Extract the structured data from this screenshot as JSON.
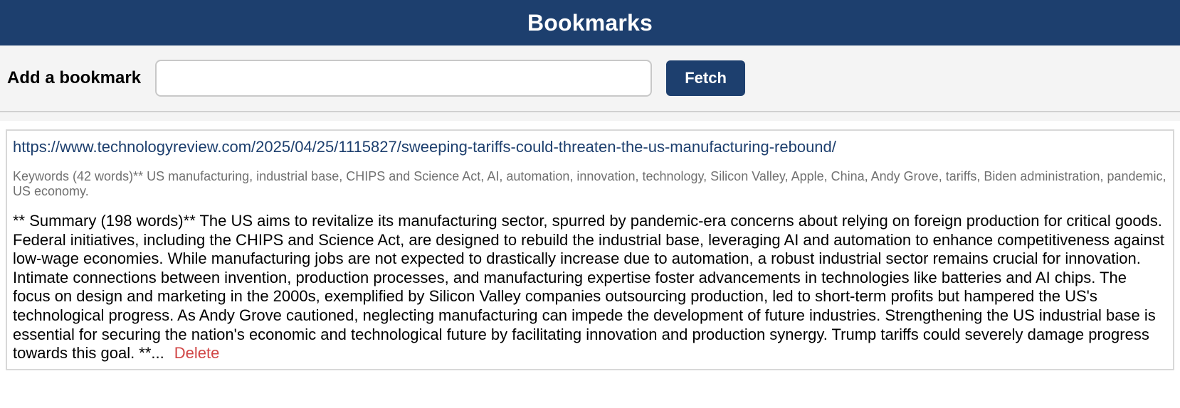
{
  "header": {
    "title": "Bookmarks"
  },
  "add_bookmark": {
    "label": "Add a bookmark",
    "input_value": "",
    "input_placeholder": "",
    "fetch_label": "Fetch"
  },
  "bookmarks": [
    {
      "url": "https://www.technologyreview.com/2025/04/25/1115827/sweeping-tariffs-could-threaten-the-us-manufacturing-rebound/",
      "keywords": "Keywords (42 words)** US manufacturing, industrial base, CHIPS and Science Act, AI, automation, innovation, technology, Silicon Valley, Apple, China, Andy Grove, tariffs, Biden administration, pandemic, US economy.",
      "summary": "** Summary (198 words)** The US aims to revitalize its manufacturing sector, spurred by pandemic-era concerns about relying on foreign production for critical goods. Federal initiatives, including the CHIPS and Science Act, are designed to rebuild the industrial base, leveraging AI and automation to enhance competitiveness against low-wage economies. While manufacturing jobs are not expected to drastically increase due to automation, a robust industrial sector remains crucial for innovation. Intimate connections between invention, production processes, and manufacturing expertise foster advancements in technologies like batteries and AI chips. The focus on design and marketing in the 2000s, exemplified by Silicon Valley companies outsourcing production, led to short-term profits but hampered the US's technological progress. As Andy Grove cautioned, neglecting manufacturing can impede the development of future industries. Strengthening the US industrial base is essential for securing the nation's economic and technological future by facilitating innovation and production synergy. Trump tariffs could severely damage progress towards this goal. **...",
      "delete_label": "Delete"
    }
  ],
  "colors": {
    "brand": "#1d3f6e",
    "delete": "#d04545",
    "keywords_text": "#707070"
  }
}
